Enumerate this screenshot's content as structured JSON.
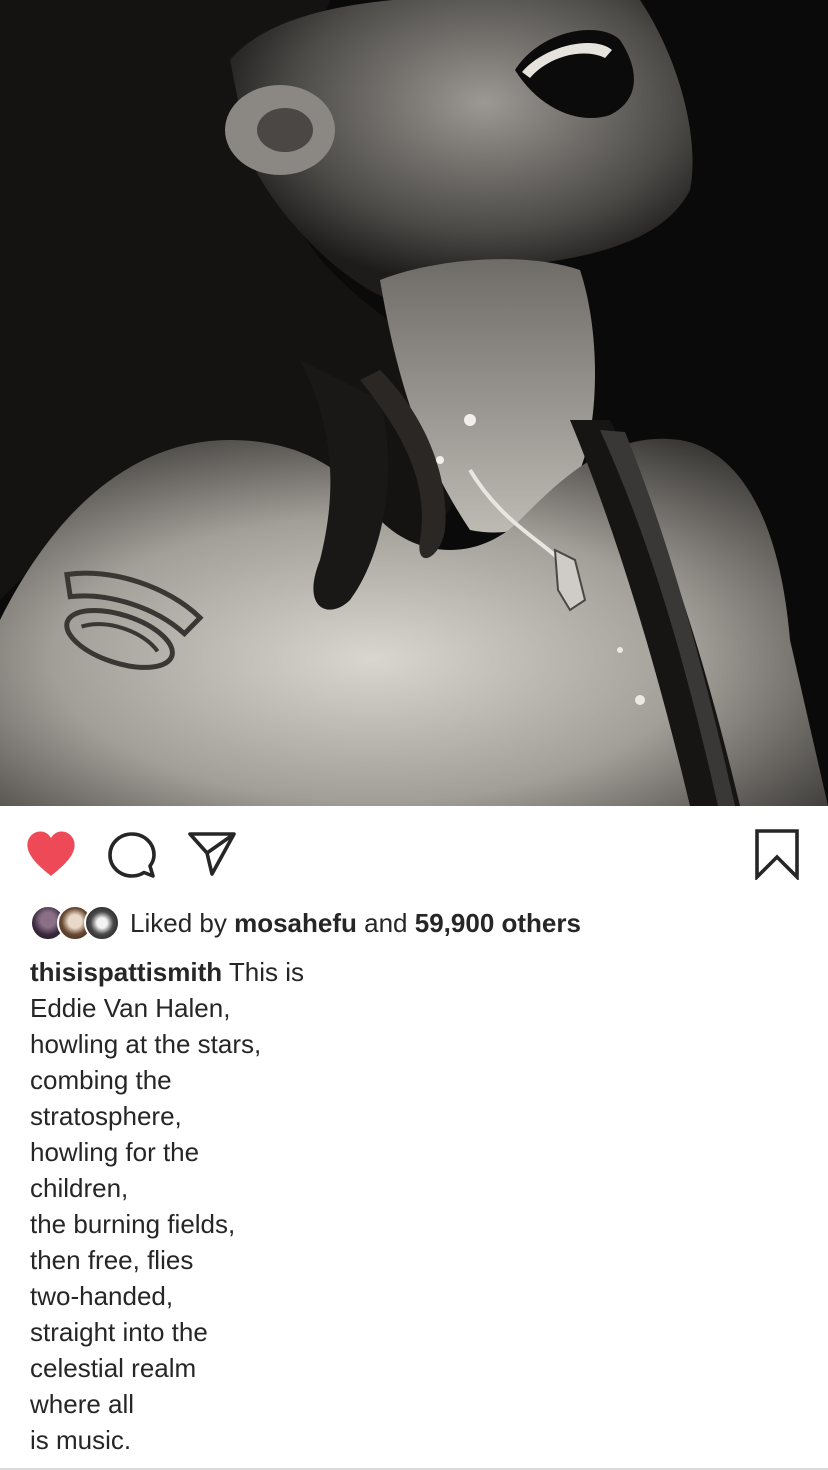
{
  "post": {
    "image_description": "",
    "likes": {
      "prefix": "Liked by",
      "first_user": "mosahefu",
      "connector": "and",
      "others": "59,900 others"
    },
    "caption": {
      "username": "thisispattismith",
      "first_line_text": "This is",
      "lines": [
        "Eddie Van Halen,",
        "howling at the stars,",
        "combing the",
        "stratosphere,",
        "howling for the",
        "children,",
        "the burning fields,",
        "then free, flies",
        "two-handed,",
        "straight into the",
        "celestial realm",
        "where all",
        "is music."
      ]
    }
  },
  "actions": {
    "like_icon": "heart-filled-icon",
    "comment_icon": "comment-bubble-icon",
    "share_icon": "paper-plane-icon",
    "save_icon": "bookmark-icon",
    "like_color": "#ed4956"
  }
}
